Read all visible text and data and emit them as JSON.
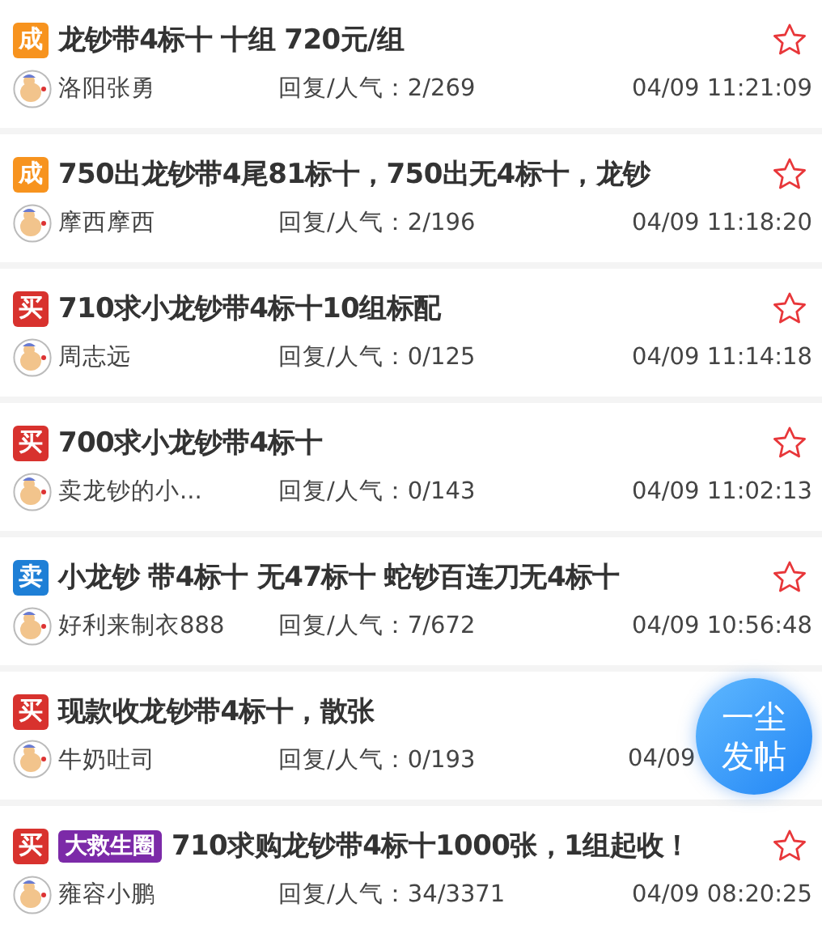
{
  "posts": [
    {
      "badge": {
        "kind": "deal",
        "text": "成"
      },
      "title": "龙钞带4标十 十组 720元/组",
      "author": "洛阳张勇",
      "stats": "回复/人气：2/269",
      "time": "04/09 11:21:09",
      "show_star": true
    },
    {
      "badge": {
        "kind": "deal",
        "text": "成"
      },
      "title": "750出龙钞带4尾81标十，750出无4标十，龙钞",
      "author": "摩西摩西",
      "stats": "回复/人气：2/196",
      "time": "04/09 11:18:20",
      "show_star": true
    },
    {
      "badge": {
        "kind": "buy",
        "text": "买"
      },
      "title": "710求小龙钞带4标十10组标配",
      "author": "周志远",
      "stats": "回复/人气：0/125",
      "time": "04/09 11:14:18",
      "show_star": true
    },
    {
      "badge": {
        "kind": "buy",
        "text": "买"
      },
      "title": "700求小龙钞带4标十",
      "author": "卖龙钞的小...",
      "stats": "回复/人气：0/143",
      "time": "04/09 11:02:13",
      "show_star": true
    },
    {
      "badge": {
        "kind": "sell",
        "text": "卖"
      },
      "title": "小龙钞 带4标十 无47标十 蛇钞百连刀无4标十",
      "author": "好利来制衣888",
      "stats": "回复/人气：7/672",
      "time": "04/09 10:56:48",
      "show_star": true
    },
    {
      "badge": {
        "kind": "buy",
        "text": "买"
      },
      "title": "现款收龙钞带4标十，散张",
      "author": "牛奶吐司",
      "stats": "回复/人气：0/193",
      "time": "04/09",
      "show_star": false
    },
    {
      "badge": {
        "kind": "buy",
        "text": "买"
      },
      "tag": "大救生圈",
      "title": "710求购龙钞带4标十1000张，1组起收！",
      "author": "雍容小鹏",
      "stats": "回复/人气：34/3371",
      "time": "04/09 08:20:25",
      "show_star": true
    }
  ],
  "fab": {
    "lines": [
      "一尘",
      "发帖"
    ]
  }
}
